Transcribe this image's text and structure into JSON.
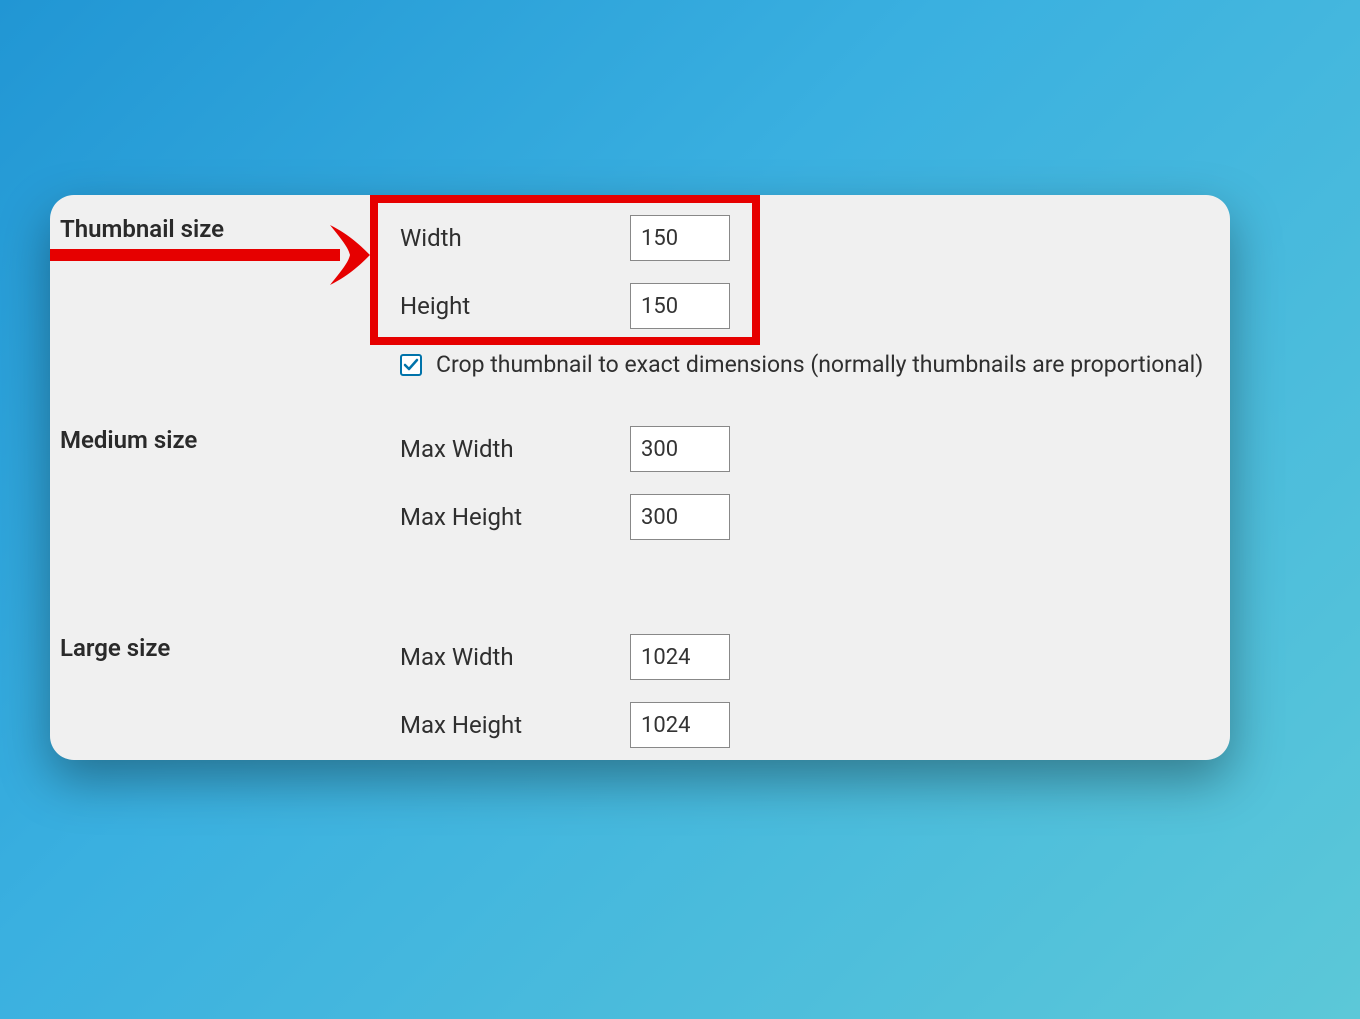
{
  "thumbnail": {
    "section_label": "Thumbnail size",
    "width_label": "Width",
    "width_value": "150",
    "height_label": "Height",
    "height_value": "150",
    "crop_checked": true,
    "crop_label": "Crop thumbnail to exact dimensions (normally thumbnails are proportional)"
  },
  "medium": {
    "section_label": "Medium size",
    "max_width_label": "Max Width",
    "max_width_value": "300",
    "max_height_label": "Max Height",
    "max_height_value": "300"
  },
  "large": {
    "section_label": "Large size",
    "max_width_label": "Max Width",
    "max_width_value": "1024",
    "max_height_label": "Max Height",
    "max_height_value": "1024"
  },
  "annotation": {
    "highlight_color": "#e60000"
  }
}
